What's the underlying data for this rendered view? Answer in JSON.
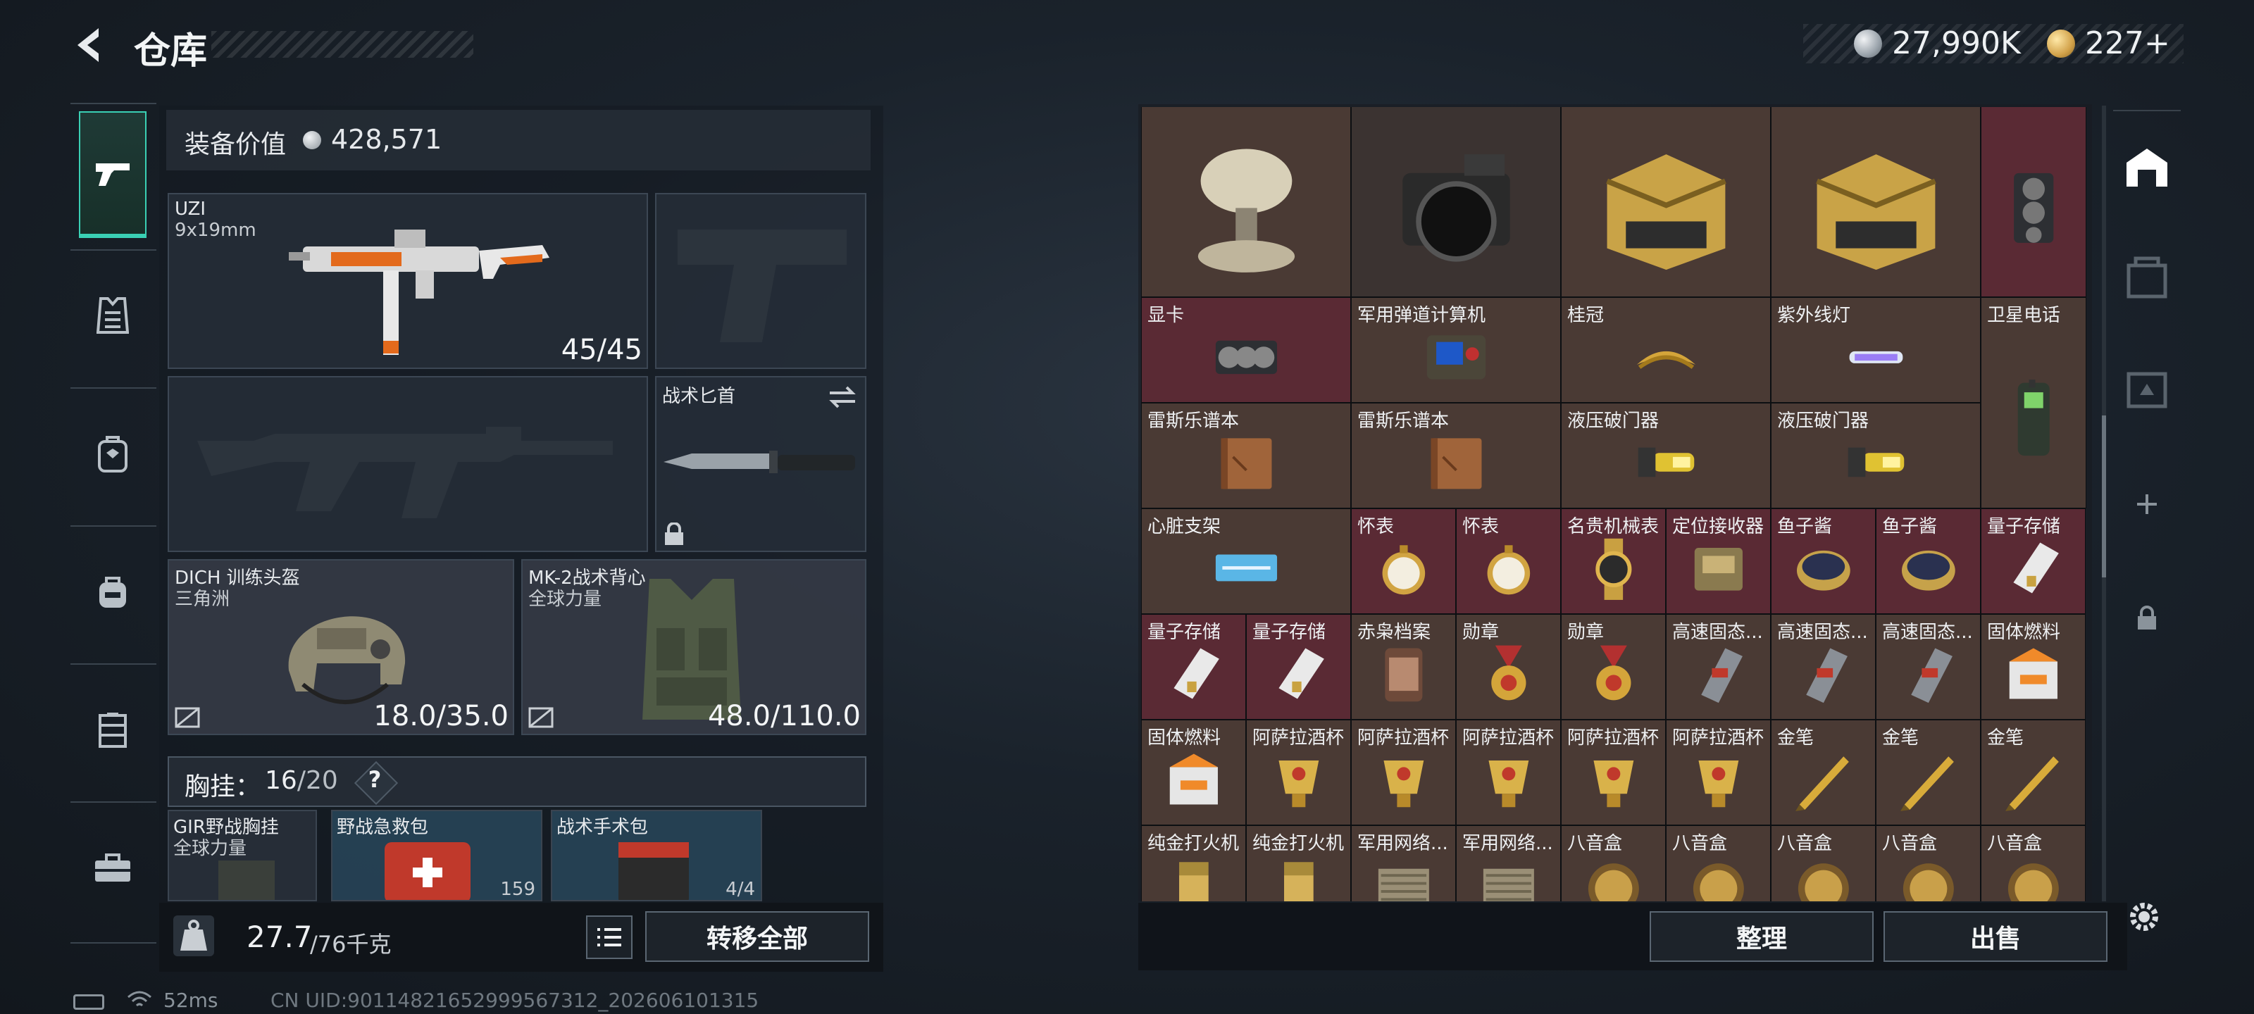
{
  "header": {
    "title": "仓库"
  },
  "currency": {
    "money": "27,990K",
    "gold": "227+"
  },
  "equipment": {
    "value_label": "装备价值",
    "value": "428,571",
    "primary": {
      "name": "UZI",
      "ammo_type": "9x19mm",
      "ammo": "45/45"
    },
    "knife": {
      "name": "战术匕首"
    },
    "helmet": {
      "name": "DICH 训练头盔",
      "brand": "三角洲",
      "durability": "18.0/35.0"
    },
    "vest": {
      "name": "MK-2战术背心",
      "brand": "全球力量",
      "durability": "48.0/110.0"
    },
    "rig": {
      "label": "胸挂：",
      "count": "16",
      "max": "/20",
      "help": "?"
    },
    "rig_items": [
      {
        "name": "GIR野战胸挂",
        "sub": "全球力量",
        "count": ""
      },
      {
        "name": "野战急救包",
        "sub": "",
        "count": "159"
      },
      {
        "name": "战术手术包",
        "sub": "",
        "count": "4/4"
      }
    ],
    "weight": {
      "value": "27.7",
      "max": "/76千克"
    },
    "transfer_all": "转移全部"
  },
  "status": {
    "ping": "52ms",
    "uid": "CN UID:9011482165299956​7312_202606101315"
  },
  "stash": {
    "buttons": {
      "organize": "整理",
      "sell": "出售"
    },
    "items": [
      {
        "label": "",
        "art": "antenna",
        "bg": "#4a3a34"
      },
      {
        "label": "",
        "art": "camera",
        "bg": "#3b3331"
      },
      {
        "label": "",
        "art": "crate",
        "bg": "#4a3a34"
      },
      {
        "label": "",
        "art": "crate",
        "bg": "#4a3a34"
      },
      {
        "label": "",
        "art": "gpu-v",
        "bg": "#5a2a34"
      },
      {
        "label": "显卡",
        "art": "gpu",
        "bg": "#5a2a34"
      },
      {
        "label": "军用弹道计算机",
        "art": "computer",
        "bg": "#4a3a34"
      },
      {
        "label": "桂冠",
        "art": "crown",
        "bg": "#4a3a34"
      },
      {
        "label": "紫外线灯",
        "art": "uvlamp",
        "bg": "#4a3a34"
      },
      {
        "label": "卫星电话",
        "art": "phone",
        "bg": "#4a3a34"
      },
      {
        "label": "雷斯乐谱本",
        "art": "book",
        "bg": "#4a3a34"
      },
      {
        "label": "雷斯乐谱本",
        "art": "book",
        "bg": "#4a3a34"
      },
      {
        "label": "液压破门器",
        "art": "breacher",
        "bg": "#4a3a34"
      },
      {
        "label": "液压破门器",
        "art": "breacher",
        "bg": "#4a3a34"
      },
      {
        "label": "心脏支架",
        "art": "stent",
        "bg": "#4a3a34"
      },
      {
        "label": "怀表",
        "art": "watch",
        "bg": "#5a2a34"
      },
      {
        "label": "怀表",
        "art": "watch",
        "bg": "#5a2a34"
      },
      {
        "label": "名贵机械表",
        "art": "wristwatch",
        "bg": "#5a2a34"
      },
      {
        "label": "定位接收器",
        "art": "receiver",
        "bg": "#5a2a34"
      },
      {
        "label": "鱼子酱",
        "art": "caviar",
        "bg": "#5a2a34"
      },
      {
        "label": "鱼子酱",
        "art": "caviar",
        "bg": "#5a2a34"
      },
      {
        "label": "量子存储",
        "art": "quantum",
        "bg": "#5a2a34"
      },
      {
        "label": "量子存储",
        "art": "quantum",
        "bg": "#5a2a34"
      },
      {
        "label": "量子存储",
        "art": "quantum",
        "bg": "#5a2a34"
      },
      {
        "label": "赤枭档案",
        "art": "jar",
        "bg": "#4a3a34"
      },
      {
        "label": "勋章",
        "art": "medal",
        "bg": "#4a3a34"
      },
      {
        "label": "勋章",
        "art": "medal",
        "bg": "#4a3a34"
      },
      {
        "label": "高速固态...",
        "art": "ssd",
        "bg": "#4a3a34"
      },
      {
        "label": "高速固态...",
        "art": "ssd",
        "bg": "#4a3a34"
      },
      {
        "label": "高速固态...",
        "art": "ssd",
        "bg": "#4a3a34"
      },
      {
        "label": "固体燃料",
        "art": "fuel",
        "bg": "#4a3a34"
      },
      {
        "label": "固体燃料",
        "art": "fuel",
        "bg": "#4a3a34"
      },
      {
        "label": "阿萨拉酒杯",
        "art": "cup",
        "bg": "#4a3a34"
      },
      {
        "label": "阿萨拉酒杯",
        "art": "cup",
        "bg": "#4a3a34"
      },
      {
        "label": "阿萨拉酒杯",
        "art": "cup",
        "bg": "#4a3a34"
      },
      {
        "label": "阿萨拉酒杯",
        "art": "cup",
        "bg": "#4a3a34"
      },
      {
        "label": "阿萨拉酒杯",
        "art": "cup",
        "bg": "#4a3a34"
      },
      {
        "label": "金笔",
        "art": "pen",
        "bg": "#4a3a34"
      },
      {
        "label": "金笔",
        "art": "pen",
        "bg": "#4a3a34"
      },
      {
        "label": "金笔",
        "art": "pen",
        "bg": "#4a3a34"
      },
      {
        "label": "纯金打火机",
        "art": "lighter",
        "bg": "#4a3a34"
      },
      {
        "label": "纯金打火机",
        "art": "lighter",
        "bg": "#4a3a34"
      },
      {
        "label": "军用网络...",
        "art": "network",
        "bg": "#4a3a34"
      },
      {
        "label": "军用网络...",
        "art": "network",
        "bg": "#4a3a34"
      },
      {
        "label": "八音盒",
        "art": "musicbox",
        "bg": "#4a3a34"
      },
      {
        "label": "八音盒",
        "art": "musicbox",
        "bg": "#4a3a34"
      },
      {
        "label": "八音盒",
        "art": "musicbox",
        "bg": "#4a3a34"
      },
      {
        "label": "八音盒",
        "art": "musicbox",
        "bg": "#4a3a34"
      },
      {
        "label": "八音盒",
        "art": "musicbox",
        "bg": "#4a3a34"
      }
    ]
  },
  "colors": {
    "accent": "#3ad0b4",
    "rare_bg": "#5a2a34",
    "normal_bg": "#4a3a34",
    "gold": "#d2a24a"
  },
  "icons": {
    "nav_left": [
      "pistol-icon",
      "armor-icon",
      "backpack-icon",
      "bag-icon",
      "rig-icon",
      "toolbox-icon"
    ],
    "nav_right": [
      "stash-icon",
      "container-icon",
      "case-icon",
      "add-icon",
      "lock-icon"
    ]
  }
}
